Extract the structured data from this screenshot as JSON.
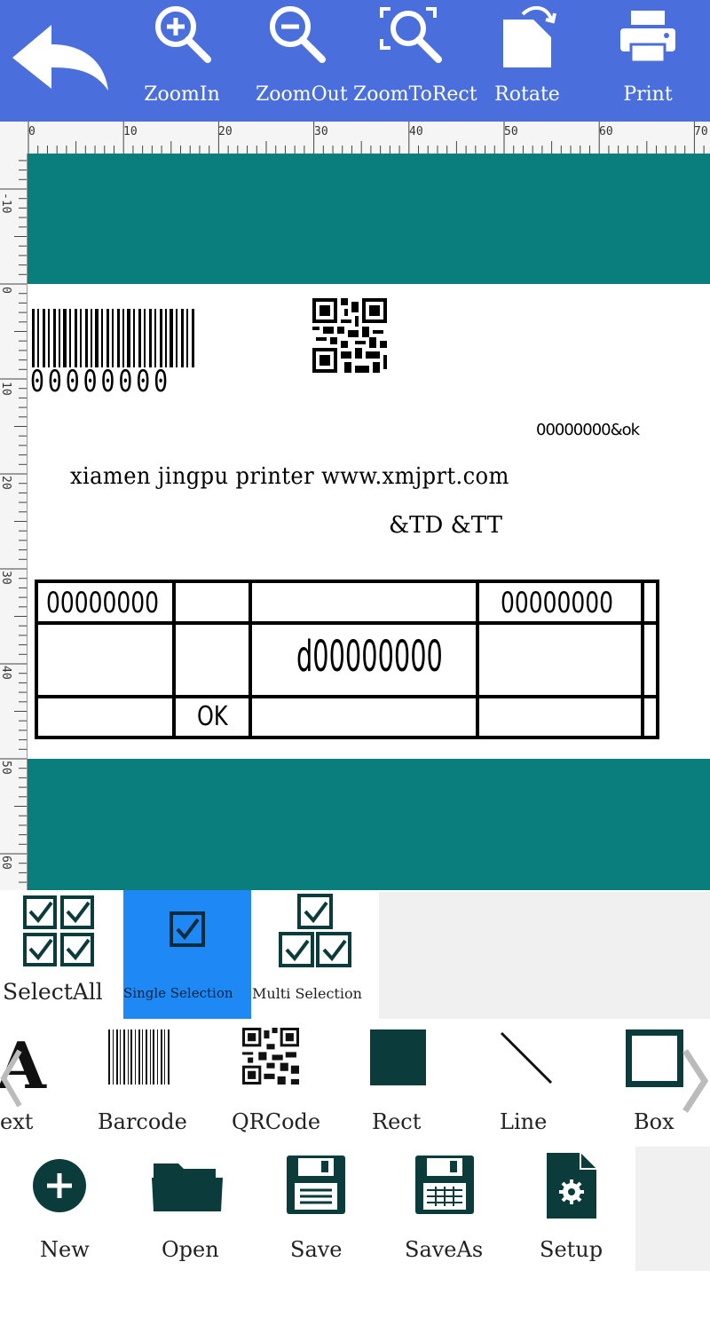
{
  "toolbar": {
    "back_icon": "back-arrow-icon",
    "buttons": [
      {
        "label": "ZoomIn",
        "icon": "zoom-in-icon"
      },
      {
        "label": "ZoomOut",
        "icon": "zoom-out-icon"
      },
      {
        "label": "ZoomToRect",
        "icon": "zoom-to-rect-icon"
      },
      {
        "label": "Rotate",
        "icon": "rotate-icon"
      },
      {
        "label": "Print",
        "icon": "printer-icon"
      }
    ],
    "background_color": "#4a6fdc"
  },
  "ruler": {
    "top_numbers": [
      "0",
      "10",
      "20",
      "30",
      "40",
      "50",
      "60",
      "70"
    ],
    "left_numbers": [
      "-10",
      "0",
      "10",
      "20",
      "30",
      "40",
      "50",
      "60"
    ]
  },
  "label": {
    "barcode_text": "00000000",
    "top_right_text": "00000000&ok",
    "company_line": "xiamen jingpu printer www.xmjprt.com",
    "date_time_line": "&TD &TT",
    "table": {
      "r1c1": "00000000",
      "r1c4": "00000000",
      "r2c3": "d00000000",
      "r3c2": "OK"
    },
    "margin_color": "#0a7d7d"
  },
  "selection": {
    "select_all": "SelectAll",
    "single": "Single Selection",
    "multi": "Multi Selection",
    "active_color": "#1e88f5"
  },
  "tools": {
    "items": [
      {
        "label": "ext",
        "icon": "text-icon"
      },
      {
        "label": "Barcode",
        "icon": "barcode-icon"
      },
      {
        "label": "QRCode",
        "icon": "qrcode-icon"
      },
      {
        "label": "Rect",
        "icon": "rect-icon"
      },
      {
        "label": "Line",
        "icon": "line-icon"
      },
      {
        "label": "Box",
        "icon": "box-icon"
      }
    ]
  },
  "actions": {
    "items": [
      {
        "label": "New",
        "icon": "plus-circle-icon"
      },
      {
        "label": "Open",
        "icon": "folder-icon"
      },
      {
        "label": "Save",
        "icon": "save-icon"
      },
      {
        "label": "SaveAs",
        "icon": "save-as-icon"
      },
      {
        "label": "Setup",
        "icon": "settings-file-icon"
      }
    ]
  }
}
